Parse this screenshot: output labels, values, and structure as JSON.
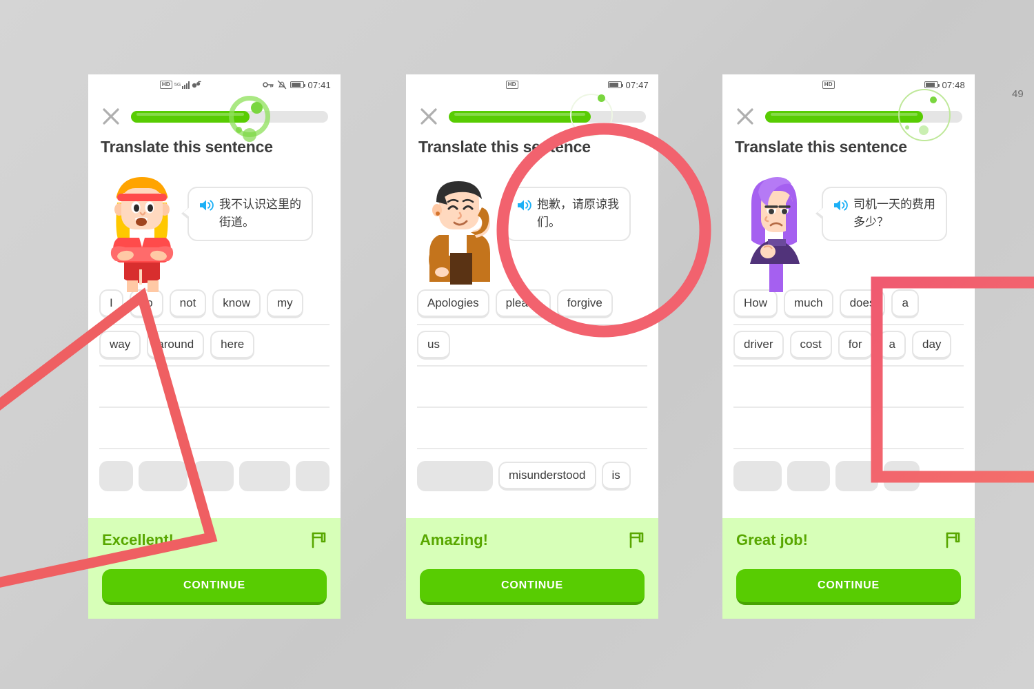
{
  "app": {
    "title": "Translate this sentence",
    "continue_label": "CONTINUE",
    "accent_green": "#58cc02",
    "footer_bg": "#d7ffb8",
    "annotation_red": "#ef5f62"
  },
  "side_label": "49",
  "phones": [
    {
      "id": "phone-1",
      "status": {
        "hd": "HD",
        "network": "5G",
        "clock": "07:41",
        "icons": [
          "hd-icon",
          "signal-bars-icon",
          "data-sync-icon",
          "vpn-key-icon",
          "bell-muted-icon",
          "battery-icon"
        ]
      },
      "progress_percent": 60,
      "title": "Translate this sentence",
      "character": "blonde-woman-red-outfit",
      "prompt_text": "我不认识这里的街道。",
      "answer_rows": [
        [
          "I",
          "do",
          "not",
          "know",
          "my"
        ],
        [
          "way",
          "around",
          "here"
        ],
        [],
        []
      ],
      "word_bank": [],
      "bank_ghosts": [
        52,
        74,
        62,
        78,
        52
      ],
      "feedback": "Excellent!",
      "continue_label": "CONTINUE"
    },
    {
      "id": "phone-2",
      "status": {
        "hd": "HD",
        "network": "",
        "clock": "07:47",
        "icons": [
          "hd-icon",
          "battery-icon"
        ]
      },
      "progress_percent": 72,
      "title": "Translate this sentence",
      "character": "dark-haired-man-orange-jacket",
      "prompt_text": "抱歉，请原谅我们。",
      "answer_rows": [
        [
          "Apologies",
          "please",
          "forgive"
        ],
        [
          "us"
        ],
        [],
        []
      ],
      "word_bank": [
        "misunderstood",
        "is"
      ],
      "bank_ghosts": [
        110
      ],
      "feedback": "Amazing!",
      "continue_label": "CONTINUE"
    },
    {
      "id": "phone-3",
      "status": {
        "hd": "HD",
        "network": "",
        "clock": "07:48",
        "icons": [
          "hd-icon",
          "battery-icon"
        ]
      },
      "progress_percent": 80,
      "title": "Translate this sentence",
      "character": "purple-haired-woman",
      "prompt_text": "司机一天的费用多少？",
      "answer_rows": [
        [
          "How",
          "much",
          "does",
          "a"
        ],
        [
          "driver",
          "cost",
          "for",
          "a",
          "day"
        ],
        [],
        []
      ],
      "word_bank": [],
      "bank_ghosts": [
        70,
        62,
        62,
        52
      ],
      "feedback": "Great job!",
      "continue_label": "CONTINUE"
    }
  ],
  "annotations": [
    {
      "name": "arrow-triangle-left",
      "shape": "polyline",
      "color": "#ef5f62"
    },
    {
      "name": "circle-highlight-center",
      "shape": "circle",
      "color": "#ef5f62"
    },
    {
      "name": "bracket-highlight-right",
      "shape": "bracket",
      "color": "#ef5f62"
    }
  ]
}
